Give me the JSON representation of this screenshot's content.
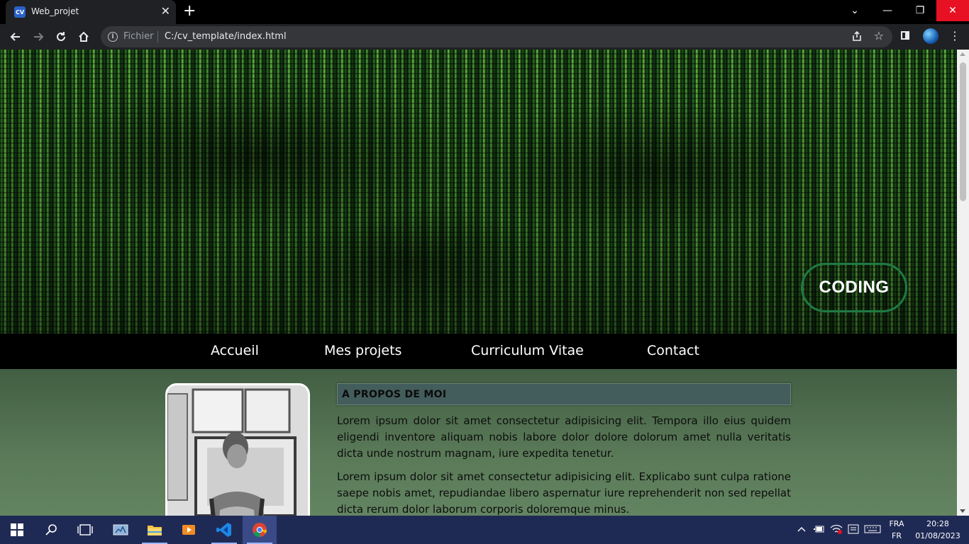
{
  "browser": {
    "tab": {
      "favicon_text": "CV",
      "title": "Web_projet",
      "close_glyph": "✕"
    },
    "new_tab_glyph": "+",
    "window_controls": {
      "minimize": "—",
      "maximize": "❐",
      "close": "✕",
      "chevron": "⌄"
    },
    "omnibox": {
      "scheme_label": "Fichier",
      "url": "C:/cv_template/index.html"
    },
    "menu_glyph": "⋮"
  },
  "page": {
    "hero": {
      "badge": "CODING"
    },
    "nav": [
      "Accueil",
      "Mes projets",
      "Curriculum Vitae",
      "Contact"
    ],
    "about": {
      "heading": "A PROPOS DE MOI",
      "paragraphs": [
        "Lorem ipsum dolor sit amet consectetur adipisicing elit. Tempora illo eius quidem eligendi inventore aliquam nobis labore dolor dolore dolorum amet nulla veritatis dicta unde nostrum magnam, iure expedita tenetur.",
        "Lorem ipsum dolor sit amet consectetur adipisicing elit. Explicabo sunt culpa ratione saepe nobis amet, repudiandae libero aspernatur iure reprehenderit non sed repellat dicta rerum dolor laborum corporis doloremque minus."
      ]
    }
  },
  "taskbar": {
    "tray": {
      "lang_line1": "FRA",
      "lang_line2": "FR",
      "time": "20:28",
      "date": "01/08/2023"
    }
  },
  "colors": {
    "accent_badge_border": "#1f7a44",
    "nav_background": "#000000",
    "content_background": "#5a7a58",
    "heading_background": "#435c5c",
    "win_close": "#e81123",
    "taskbar": "#1f2a54"
  }
}
